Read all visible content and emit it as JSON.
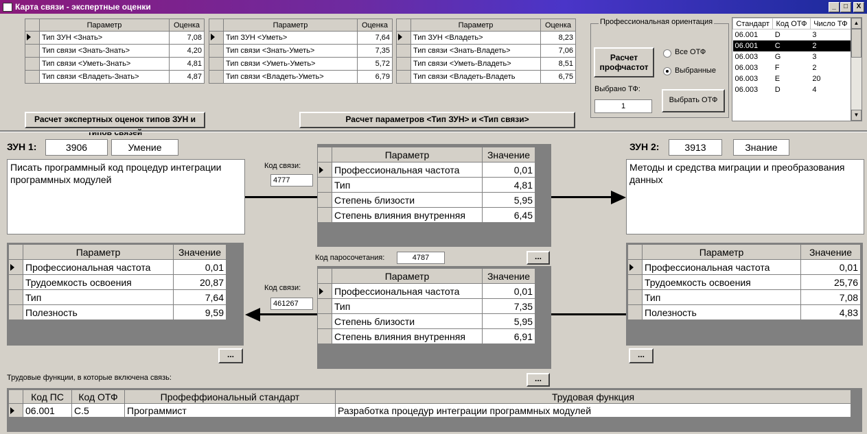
{
  "window": {
    "title": "Карта связи - экспертные оценки",
    "min": "_",
    "max": "□",
    "close": "X"
  },
  "top_tables": {
    "col_param": "Параметр",
    "col_score": "Оценка",
    "know": [
      {
        "p": "Тип ЗУН <Знать>",
        "v": "7,08"
      },
      {
        "p": "Тип связи <Знать-Знать>",
        "v": "4,20"
      },
      {
        "p": "Тип связи <Уметь-Знать>",
        "v": "4,81"
      },
      {
        "p": "Тип связи <Владеть-Знать>",
        "v": "4,87"
      }
    ],
    "skill": [
      {
        "p": "Тип ЗУН <Уметь>",
        "v": "7,64"
      },
      {
        "p": "Тип связи <Знать-Уметь>",
        "v": "7,35"
      },
      {
        "p": "Тип связи <Уметь-Уметь>",
        "v": "5,72"
      },
      {
        "p": "Тип связи <Владеть-Уметь>",
        "v": "6,79"
      }
    ],
    "own": [
      {
        "p": "Тип ЗУН <Владеть>",
        "v": "8,23"
      },
      {
        "p": "Тип связи <Знать-Владеть>",
        "v": "7,06"
      },
      {
        "p": "Тип связи <Уметь-Владеть>",
        "v": "8,51"
      },
      {
        "p": "Тип связи <Владеть-Владеть",
        "v": "6,75"
      }
    ]
  },
  "buttons": {
    "calc_expert": "Расчет экспертных оценок типов ЗУН и типов связей",
    "calc_params": "Расчет параметров <Тип ЗУН> и <Тип связи>",
    "calc_freq_1": "Расчет",
    "calc_freq_2": "профчастот",
    "select_otf": "Выбрать ОТФ",
    "more": "..."
  },
  "prof": {
    "group_title": "Профессиональная ориентация",
    "all_otf": "Все ОТФ",
    "selected": "Выбранные",
    "selected_tf_label": "Выбрано ТФ:",
    "selected_tf_value": "1",
    "list_headers": [
      "Стандарт",
      "Код ОТФ",
      "Число ТФ"
    ],
    "list_rows": [
      [
        "06.001",
        "D",
        "3"
      ],
      [
        "06.001",
        "C",
        "2"
      ],
      [
        "06.003",
        "G",
        "3"
      ],
      [
        "06.003",
        "F",
        "2"
      ],
      [
        "06.003",
        "E",
        "20"
      ],
      [
        "06.003",
        "D",
        "4"
      ]
    ]
  },
  "zun1": {
    "label": "ЗУН 1:",
    "id": "3906",
    "type": "Умение",
    "text": "Писать программный код процедур интеграции программных модулей",
    "params": [
      {
        "p": "Профессиональная частота",
        "v": "0,01"
      },
      {
        "p": "Трудоемкость освоения",
        "v": "20,87"
      },
      {
        "p": "Тип",
        "v": "7,64"
      },
      {
        "p": "Полезность",
        "v": "9,59"
      }
    ]
  },
  "zun2": {
    "label": "ЗУН 2:",
    "id": "3913",
    "type": "Знание",
    "text": "Методы и средства миграции и преобразования данных",
    "params": [
      {
        "p": "Профессиональная частота",
        "v": "0,01"
      },
      {
        "p": "Трудоемкость освоения",
        "v": "25,76"
      },
      {
        "p": "Тип",
        "v": "7,08"
      },
      {
        "p": "Полезность",
        "v": "4,83"
      }
    ]
  },
  "col_param": "Параметр",
  "col_value": "Значение",
  "link1": {
    "code_label": "Код связи:",
    "code": "4777",
    "params": [
      {
        "p": "Профессиональная частота",
        "v": "0,01"
      },
      {
        "p": "Тип",
        "v": "4,81"
      },
      {
        "p": "Степень близости",
        "v": "5,95"
      },
      {
        "p": "Степень влияния внутренняя",
        "v": "6,45"
      }
    ]
  },
  "pairing": {
    "label": "Код паросочетания:",
    "code": "4787"
  },
  "link2": {
    "code_label": "Код связи:",
    "code": "461267",
    "params": [
      {
        "p": "Профессиональная частота",
        "v": "0,01"
      },
      {
        "p": "Тип",
        "v": "7,35"
      },
      {
        "p": "Степень близости",
        "v": "5,95"
      },
      {
        "p": "Степень влияния внутренняя",
        "v": "6,91"
      }
    ]
  },
  "functions": {
    "title": "Трудовые функции, в которые включена связь:",
    "headers": [
      "Код ПС",
      "Код ОТФ",
      "Профеффиональный стандарт",
      "Трудовая функция"
    ],
    "rows": [
      [
        "06.001",
        "C.5",
        "Программист",
        "Разработка процедур интеграции программных модулей"
      ]
    ]
  }
}
